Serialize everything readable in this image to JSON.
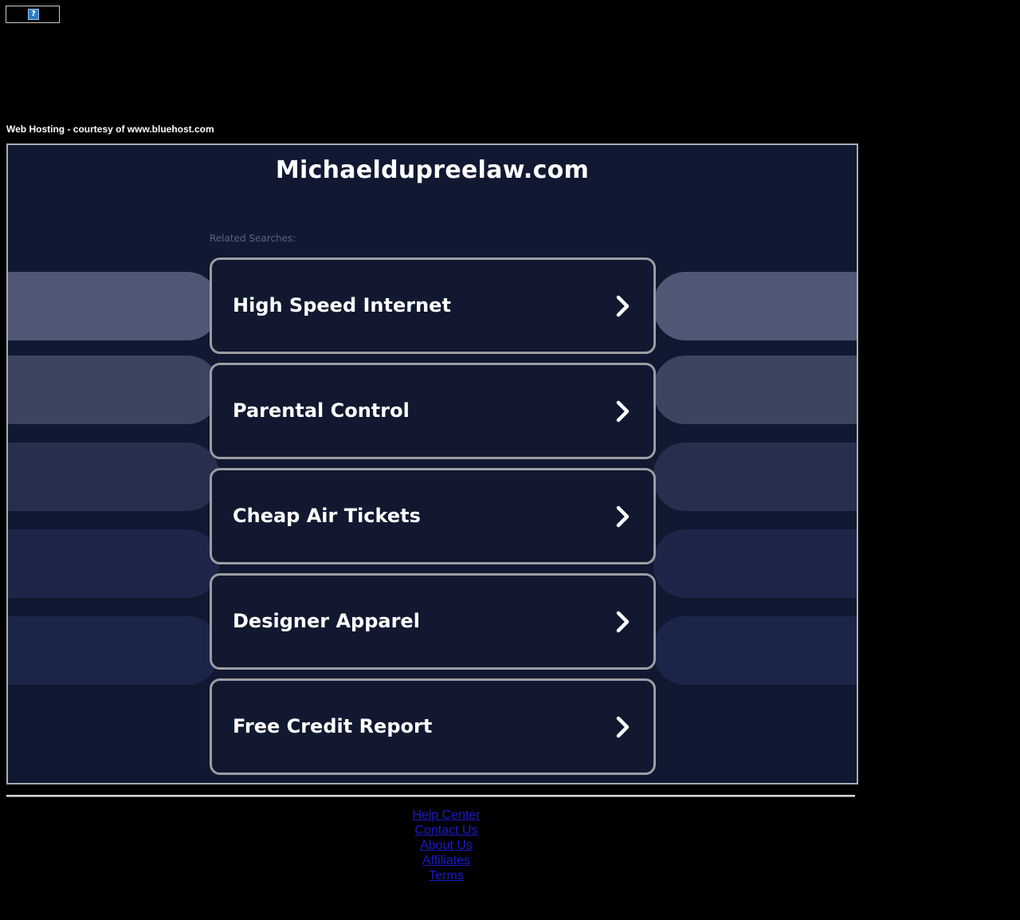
{
  "top_image": {
    "icon": "broken-image-icon",
    "glyph": "?"
  },
  "courtesy_text": "Web Hosting - courtesy of www.bluehost.com",
  "site_title": "Michaeldupreelaw.com",
  "related_label": "Related Searches:",
  "searches": [
    {
      "label": "High Speed Internet",
      "icon": "chevron-right-icon"
    },
    {
      "label": "Parental Control",
      "icon": "chevron-right-icon"
    },
    {
      "label": "Cheap Air Tickets",
      "icon": "chevron-right-icon"
    },
    {
      "label": "Designer Apparel",
      "icon": "chevron-right-icon"
    },
    {
      "label": "Free Credit Report",
      "icon": "chevron-right-icon"
    }
  ],
  "band_colors": [
    "#4e5874",
    "#3c4560",
    "#262f4d",
    "#1d2649",
    "#1b2548"
  ],
  "colors": {
    "panel_bg": "#111831",
    "card_border": "#9c9ea2",
    "link": "#1a1acc"
  },
  "footer_links": [
    {
      "label": "Help Center"
    },
    {
      "label": "Contact Us"
    },
    {
      "label": "About Us"
    },
    {
      "label": "Affiliates"
    },
    {
      "label": "Terms"
    }
  ]
}
